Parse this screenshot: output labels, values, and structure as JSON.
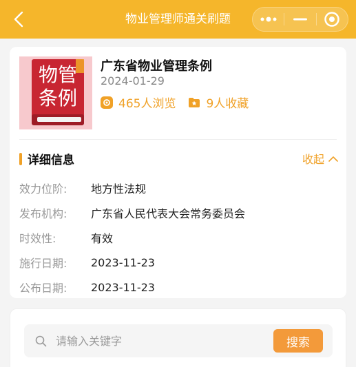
{
  "navbar": {
    "title": "物业管理师通关刷题",
    "back_icon": "chevron-left-icon",
    "more_icon": "more-dots-icon",
    "minimize_icon": "minimize-icon",
    "close_icon": "target-circle-icon"
  },
  "document": {
    "cover_text": "物管条例",
    "title": "广东省物业管理条例",
    "date": "2024-01-29",
    "views_text": "465人浏览",
    "favorites_text": "9人收藏"
  },
  "details": {
    "section_title": "详细信息",
    "collapse_label": "收起",
    "rows": [
      {
        "label": "效力位阶:",
        "value": "地方性法规"
      },
      {
        "label": "发布机构:",
        "value": "广东省人民代表大会常务委员会"
      },
      {
        "label": "时效性:",
        "value": "有效"
      },
      {
        "label": "施行日期:",
        "value": "2023-11-23"
      },
      {
        "label": "公布日期:",
        "value": "2023-11-23"
      }
    ]
  },
  "search": {
    "placeholder": "请输入关键字",
    "value": "",
    "button_label": "搜索"
  },
  "colors": {
    "brand": "#f5b62b",
    "accent": "#f0a127",
    "search_button": "#f39a3a"
  }
}
